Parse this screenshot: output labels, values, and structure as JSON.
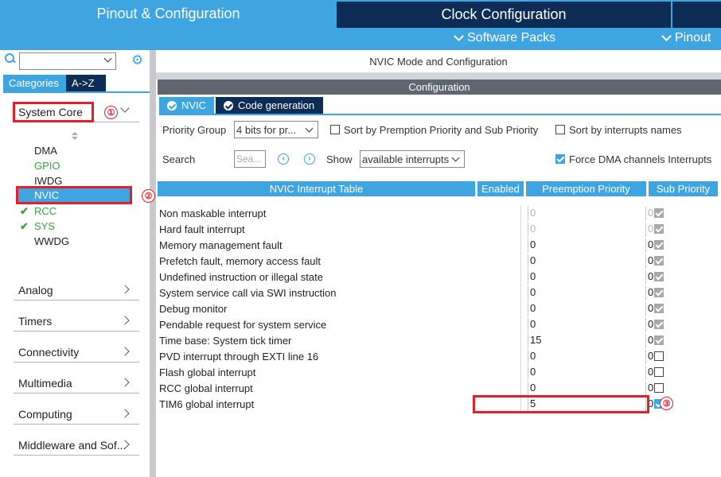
{
  "top_tabs": {
    "pinout_config": "Pinout & Configuration",
    "clock_config": "Clock Configuration"
  },
  "sub_menu": {
    "software_packs": "Software Packs",
    "pinout": "Pinout"
  },
  "left_panel": {
    "search_value": "",
    "tabs": [
      "Categories",
      "A->Z"
    ],
    "system_core_label": "System Core",
    "system_core_items": [
      {
        "label": "DMA",
        "state": "normal"
      },
      {
        "label": "GPIO",
        "state": "green"
      },
      {
        "label": "IWDG",
        "state": "normal"
      },
      {
        "label": "NVIC",
        "state": "selected"
      },
      {
        "label": "RCC",
        "state": "checked"
      },
      {
        "label": "SYS",
        "state": "checked"
      },
      {
        "label": "WWDG",
        "state": "normal"
      }
    ],
    "groups": [
      "Analog",
      "Timers",
      "Connectivity",
      "Multimedia",
      "Computing",
      "Middleware and Sof..."
    ]
  },
  "annotations": [
    "①",
    "②",
    "③"
  ],
  "main": {
    "title": "NVIC Mode and Configuration",
    "config_header": "Configuration",
    "tabs": [
      "NVIC",
      "Code generation"
    ],
    "priority_group_label": "Priority Group",
    "priority_group_value": "4 bits for pr...",
    "sort_premption_label": "Sort by Premption Priority and Sub Priority",
    "sort_names_label": "Sort by interrupts names",
    "search_label": "Search",
    "search_placeholder": "Sea...",
    "show_label": "Show",
    "show_value": "available interrupts",
    "force_dma_label": "Force DMA channels Interrupts",
    "table": {
      "headers": [
        "NVIC Interrupt Table",
        "Enabled",
        "Preemption Priority",
        "Sub Priority"
      ],
      "rows": [
        {
          "name": "Non maskable interrupt",
          "enabled": "locked",
          "pre": "0",
          "sub": "0",
          "dim": true
        },
        {
          "name": "Hard fault interrupt",
          "enabled": "locked",
          "pre": "0",
          "sub": "0",
          "dim": true
        },
        {
          "name": "Memory management fault",
          "enabled": "locked",
          "pre": "0",
          "sub": "0",
          "dim": false
        },
        {
          "name": "Prefetch fault, memory access fault",
          "enabled": "locked",
          "pre": "0",
          "sub": "0",
          "dim": false
        },
        {
          "name": "Undefined instruction or illegal state",
          "enabled": "locked",
          "pre": "0",
          "sub": "0",
          "dim": false
        },
        {
          "name": "System service call via SWI instruction",
          "enabled": "locked",
          "pre": "0",
          "sub": "0",
          "dim": false
        },
        {
          "name": "Debug monitor",
          "enabled": "locked",
          "pre": "0",
          "sub": "0",
          "dim": false
        },
        {
          "name": "Pendable request for system service",
          "enabled": "locked",
          "pre": "0",
          "sub": "0",
          "dim": false
        },
        {
          "name": "Time base: System tick timer",
          "enabled": "locked",
          "pre": "15",
          "sub": "0",
          "dim": false
        },
        {
          "name": "PVD interrupt through EXTI line 16",
          "enabled": "off",
          "pre": "0",
          "sub": "0",
          "dim": false
        },
        {
          "name": "Flash global interrupt",
          "enabled": "off",
          "pre": "0",
          "sub": "0",
          "dim": false
        },
        {
          "name": "RCC global interrupt",
          "enabled": "off",
          "pre": "0",
          "sub": "0",
          "dim": false
        },
        {
          "name": "TIM6 global interrupt",
          "enabled": "on",
          "pre": "5",
          "sub": "0",
          "dim": false
        }
      ]
    }
  },
  "colors": {
    "accent": "#3ea5e0",
    "dark_tab": "#0d2d56",
    "annotation_red": "#e3202a",
    "status_green": "#3fa33f"
  }
}
